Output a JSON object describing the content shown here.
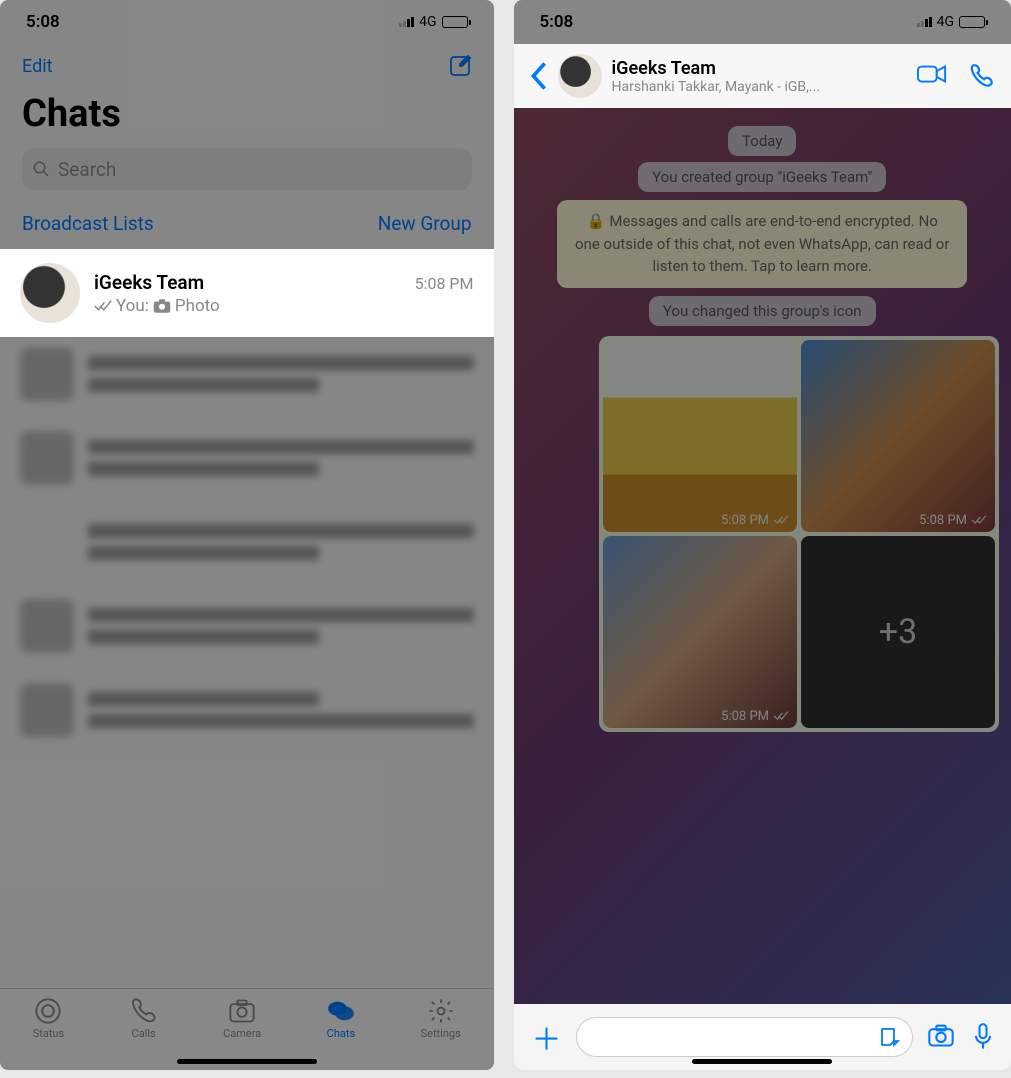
{
  "statusbar": {
    "time": "5:08",
    "network": "4G"
  },
  "left": {
    "edit": "Edit",
    "title": "Chats",
    "search_placeholder": "Search",
    "broadcast": "Broadcast Lists",
    "newgroup": "New Group",
    "chat": {
      "name": "iGeeks Team",
      "time": "5:08 PM",
      "preview_prefix": "You:",
      "preview_label": "Photo"
    },
    "tabs": {
      "status": "Status",
      "calls": "Calls",
      "camera": "Camera",
      "chats": "Chats",
      "settings": "Settings"
    }
  },
  "right": {
    "group_name": "iGeeks Team",
    "members": "Harshanki Takkar, Mayank - iGB,...",
    "date_pill": "Today",
    "created_msg": "You created group \"iGeeks Team\"",
    "encryption_msg": "Messages and calls are end-to-end encrypted. No one outside of this chat, not even WhatsApp, can read or listen to them. Tap to learn more.",
    "icon_change_msg": "You changed this group's icon",
    "media_time": "5:08 PM",
    "more_count": "+3"
  }
}
